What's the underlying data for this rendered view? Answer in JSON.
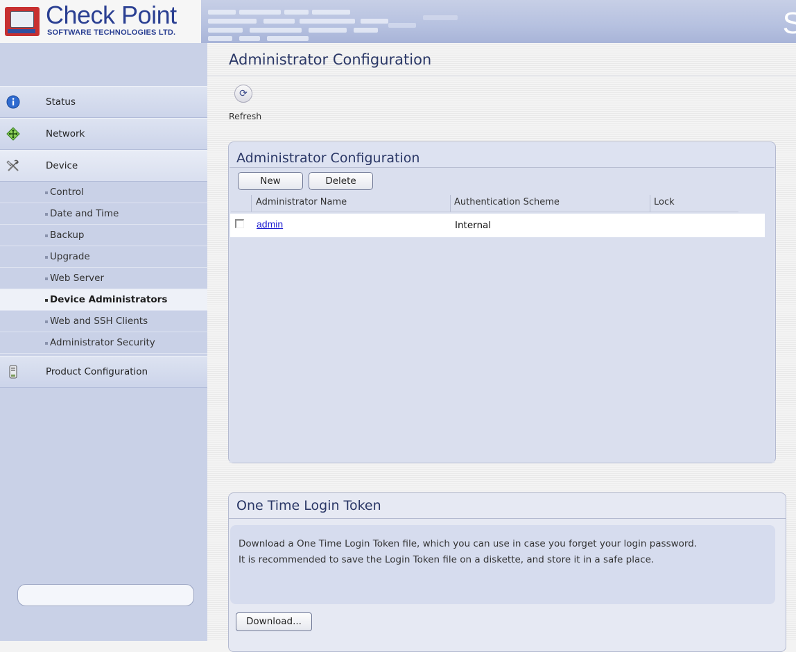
{
  "header": {
    "brand": "Check Point",
    "brand_sub": "SOFTWARE TECHNOLOGIES LTD.",
    "right_glyph": "S"
  },
  "sidebar": {
    "main_items": [
      {
        "label": "Status",
        "icon": "info-icon"
      },
      {
        "label": "Network",
        "icon": "network-icon"
      },
      {
        "label": "Device",
        "icon": "tools-icon"
      },
      {
        "label": "Product Configuration",
        "icon": "device-icon"
      }
    ],
    "device_sub_items": [
      {
        "label": "Control"
      },
      {
        "label": "Date and Time"
      },
      {
        "label": "Backup"
      },
      {
        "label": "Upgrade"
      },
      {
        "label": "Web Server"
      },
      {
        "label": "Device Administrators"
      },
      {
        "label": "Web and SSH Clients"
      },
      {
        "label": "Administrator Security"
      }
    ],
    "active_sub_item": "Device Administrators"
  },
  "main": {
    "page_title": "Administrator Configuration",
    "refresh_label": "Refresh",
    "admin_panel": {
      "title": "Administrator Configuration",
      "new_label": "New",
      "delete_label": "Delete",
      "columns": [
        "Administrator Name",
        "Authentication Scheme",
        "Lock"
      ],
      "rows": [
        {
          "name": "admin",
          "auth": "Internal",
          "lock": ""
        }
      ]
    },
    "token_panel": {
      "title": "One Time Login Token",
      "line1": "Download a One Time Login Token file, which you can use in case you forget your login password.",
      "line2": "It is recommended to save the Login Token file on a diskette, and store it in a safe place.",
      "download_label": "Download..."
    }
  },
  "colors": {
    "accent_title": "#2a3766",
    "brand_blue": "#2a3f92",
    "link": "#1a1ad0",
    "sidebar_bg": "#c9d1e7",
    "panel_bg": "#dde2f1"
  }
}
